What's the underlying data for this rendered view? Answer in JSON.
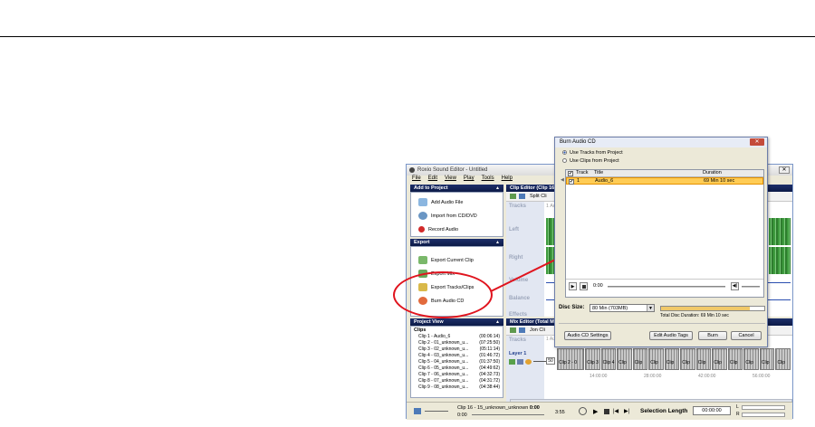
{
  "app": {
    "title": "Roxio Sound Editor - Untitled",
    "menu": [
      "File",
      "Edit",
      "View",
      "Play",
      "Tools",
      "Help"
    ],
    "add_panel": {
      "header": "Add to Project",
      "items": [
        "Add Audio File",
        "Import from CD/DVD",
        "Record Audio"
      ]
    },
    "export_panel": {
      "header": "Export",
      "items": [
        "Export Current Clip",
        "Export Mix",
        "Export Tracks/Clips",
        "Burn Audio CD"
      ]
    },
    "project_view": {
      "header": "Project View",
      "root": "Clips",
      "clips": [
        {
          "name": "Clip 1 - Audio_6",
          "dur": "(00:06:14)"
        },
        {
          "name": "Clip 2 - 01_unknown_u...",
          "dur": "(07:25:50)"
        },
        {
          "name": "Clip 3 - 02_unknown_u...",
          "dur": "(05:11:14)"
        },
        {
          "name": "Clip 4 - 03_unknown_u...",
          "dur": "(01:46:72)"
        },
        {
          "name": "Clip 5 - 04_unknown_u...",
          "dur": "(01:37:50)"
        },
        {
          "name": "Clip 6 - 05_unknown_u...",
          "dur": "(04:49:62)"
        },
        {
          "name": "Clip 7 - 06_unknown_u...",
          "dur": "(04:32:73)"
        },
        {
          "name": "Clip 8 - 07_unknown_u...",
          "dur": "(04:31:72)"
        },
        {
          "name": "Clip 9 - 08_unknown_u...",
          "dur": "(04:38:44)"
        }
      ]
    },
    "clip_editor": {
      "header": "Clip Editor (Clip 16",
      "split_label": "Split Cli",
      "tracks_label": "Tracks",
      "track_num": "1 Audi",
      "channels": [
        "Left",
        "Right",
        "Volume",
        "Balance",
        "Effects"
      ]
    },
    "mix_editor": {
      "header": "Mix Editor (Total Mi",
      "tool_label": "Jon Cli",
      "tracks_label": "Tracks",
      "layer": "Layer 1",
      "layer_value": "50",
      "timeline": [
        "14:00:00",
        "28:00:00",
        "42:00:00",
        "56:00:00"
      ],
      "clip_blocks": [
        "Clip 2 - 0",
        "Clip 3",
        "Clip 4",
        "Clip",
        "Clip",
        "Clip",
        "Clip",
        "Clip",
        "Clip",
        "Clip",
        "Clip",
        "Clip",
        "Clip",
        "Clip"
      ],
      "audio_tag": "1 Audio_6"
    },
    "transport": {
      "clip_text": "Clip 16 - 15_unknown_unknown",
      "clip_time": "0:00",
      "start": "0:00",
      "end": "3:55",
      "selection_label": "Selection Length",
      "selection_value": "00:00:00",
      "lr_left": "L",
      "lr_right": "R"
    }
  },
  "dialog": {
    "title": "Burn Audio CD",
    "option_tracks": "Use Tracks from Project",
    "option_clips": "Use Clips from Project",
    "columns": {
      "track": "Track",
      "title": "Title",
      "duration": "Duration"
    },
    "rows": [
      {
        "track": "1",
        "title": "Audio_6",
        "duration": "69 Min 10 sec"
      }
    ],
    "position": "0:00",
    "disc_size_label": "Disc Size:",
    "disc_size_value": "80 Min (703MB)",
    "total_label": "Total Disc Duration: 69 Min 10 sec",
    "progress_fraction": 0.86,
    "buttons": {
      "settings": "Audio CD Settings",
      "edit_tags": "Edit Audio Tags",
      "burn": "Burn",
      "cancel": "Cancel"
    }
  },
  "colors": {
    "highlight": "#e0141e",
    "panel_header": "#0c1a48",
    "row_select": "#ffcc55",
    "wave": "#3e9b3e"
  }
}
